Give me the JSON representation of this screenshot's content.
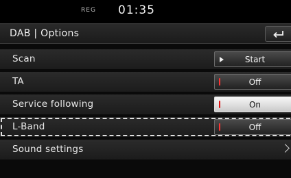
{
  "status": {
    "reg": "REG",
    "time": "01:35"
  },
  "header": {
    "title": "DAB | Options",
    "back_icon": "back-return-icon"
  },
  "rows": [
    {
      "label": "Scan",
      "control": "Start",
      "control_icon": "play-icon"
    },
    {
      "label": "TA",
      "control": "Off",
      "control_icon": "indicator-icon"
    },
    {
      "label": "Service following",
      "control": "On",
      "control_icon": "indicator-icon"
    },
    {
      "label": "L-Band",
      "control": "Off",
      "control_icon": "indicator-icon",
      "selected": true
    },
    {
      "label": "Sound settings",
      "control_icon": "chevron-right-icon"
    }
  ],
  "colors": {
    "indicator": "#ff3333",
    "on_background": "#f0f0f0",
    "row_background": "#222222"
  }
}
